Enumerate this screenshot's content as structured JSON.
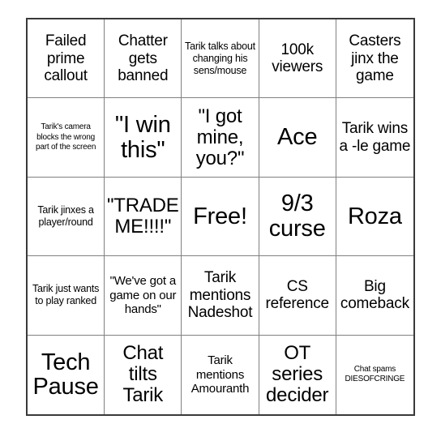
{
  "card": {
    "type": "bingo-card",
    "columns": 5,
    "rows": 5,
    "border_color": "#3a3a3a",
    "grid_line_color": "#808080",
    "background_color": "#ffffff",
    "text_color": "#000000",
    "cells": [
      {
        "text": "Failed prime callout",
        "size": "lg"
      },
      {
        "text": "Chatter gets banned",
        "size": "lg"
      },
      {
        "text": "Tarik talks about changing his sens/mouse",
        "size": "sm"
      },
      {
        "text": "100k viewers",
        "size": "lg"
      },
      {
        "text": "Casters jinx the game",
        "size": "lg"
      },
      {
        "text": "Tarik's camera blocks the wrong part of the screen",
        "size": "xs"
      },
      {
        "text": "\"I win this\"",
        "size": "xxl"
      },
      {
        "text": "\"I got mine, you?\"",
        "size": "xl"
      },
      {
        "text": "Ace",
        "size": "xxl"
      },
      {
        "text": "Tarik wins a -le game",
        "size": "lg"
      },
      {
        "text": "Tarik jinxes a player/round",
        "size": "sm"
      },
      {
        "text": "\"TRADE ME!!!!\"",
        "size": "xl"
      },
      {
        "text": "Free!",
        "size": "xxl"
      },
      {
        "text": "9/3 curse",
        "size": "xxl"
      },
      {
        "text": "Roza",
        "size": "xxl"
      },
      {
        "text": "Tarik just wants to play ranked",
        "size": "sm"
      },
      {
        "text": "\"We've got a game on our hands\"",
        "size": "md"
      },
      {
        "text": "Tarik mentions Nadeshot",
        "size": "lg"
      },
      {
        "text": "CS reference",
        "size": "lg"
      },
      {
        "text": "Big comeback",
        "size": "lg"
      },
      {
        "text": "Tech Pause",
        "size": "xxl"
      },
      {
        "text": "Chat tilts Tarik",
        "size": "xl"
      },
      {
        "text": "Tarik mentions Amouranth",
        "size": "md"
      },
      {
        "text": "OT series decider",
        "size": "xl"
      },
      {
        "text": "Chat spams DIESOFCRINGE",
        "size": "xs"
      }
    ]
  }
}
